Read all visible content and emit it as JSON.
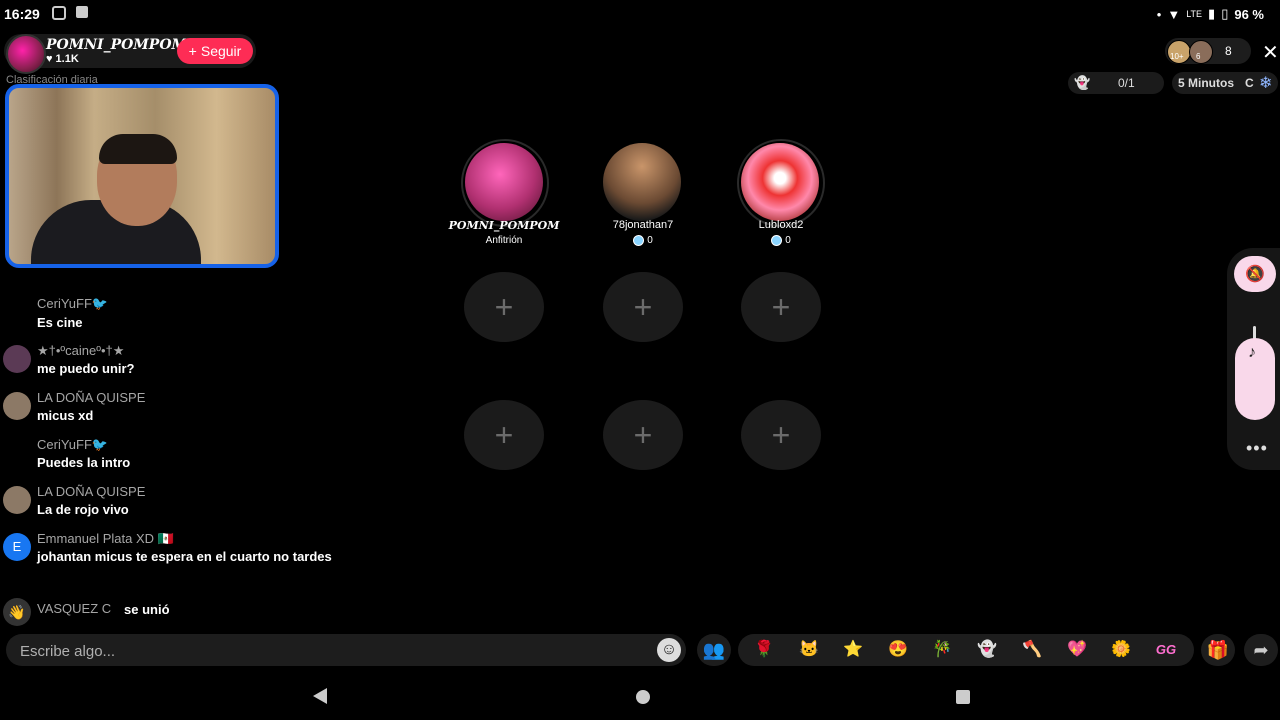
{
  "status_bar": {
    "time": "16:29",
    "battery": "96 %",
    "network": "LTE"
  },
  "host": {
    "name": "POMNI_POMPOM",
    "likes": "1.1K",
    "follow_label": "Seguir",
    "ranking_label": "Clasificación diaria"
  },
  "viewers": {
    "count": "8",
    "avatar_badges": [
      "10+",
      "6"
    ]
  },
  "room": {
    "seats": "0/1",
    "timer": "5 Minutos",
    "timer_suffix": "C"
  },
  "guests": [
    {
      "name": "POMNI_POMPOM",
      "sub": "Anfitrión"
    },
    {
      "name": "78jonathan7",
      "sub": "0"
    },
    {
      "name": "Lubloxd2",
      "sub": "0"
    }
  ],
  "chat": [
    {
      "user": "CeriYuFF🐦",
      "text": "Es cine"
    },
    {
      "user": "★†•ºcaineº•†★",
      "text": "me puedo unir?"
    },
    {
      "user": "LA DOÑA QUISPE",
      "text": "micus xd"
    },
    {
      "user": "CeriYuFF🐦",
      "text": "Puedes la intro"
    },
    {
      "user": "LA DOÑA QUISPE",
      "text": "La de rojo vivo"
    },
    {
      "user": "Emmanuel Plata XD 🇲🇽",
      "text": "johantan micus te espera en el cuarto no tardes",
      "avatar_letter": "E"
    },
    {
      "user": "VASQUEZ C",
      "text": "se unió"
    }
  ],
  "input": {
    "placeholder": "Escribe algo..."
  },
  "gifts": [
    "🌹",
    "🐱",
    "⭐",
    "😍",
    "🎋",
    "👻",
    "🪓",
    "💖",
    "🌼",
    "GG"
  ],
  "colors": {
    "accent": "#fe2c55",
    "camera_border": "#1662e8",
    "panel_pink": "#f9d8ea"
  }
}
